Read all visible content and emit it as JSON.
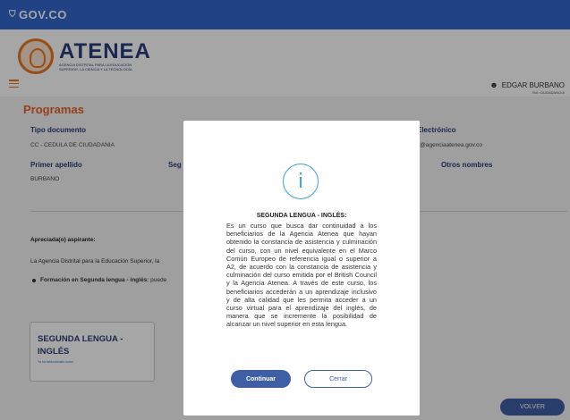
{
  "gov_bar": {
    "logo": "GOV.CO"
  },
  "brand": {
    "name": "ATENEA",
    "subtitle": "AGENCIA DISTRITAL PARA LA EDUCACIÓN SUPERIOR, LA CIENCIA Y LA TECNOLOGÍA"
  },
  "user": {
    "name": "EDGAR BURBANO",
    "role": "Rol: CIUDADANO/A"
  },
  "page": {
    "title": "Programas",
    "fields": {
      "tipo_documento_label": "Tipo documento",
      "tipo_documento_value": "CC - CEDULA DE CIUDADANIA",
      "correo_label": "Electrónico",
      "correo_value": "z@agenciaatenea.gov.co",
      "primer_apellido_label": "Primer apellido",
      "primer_apellido_value": "BURBANO",
      "segundo_label": "Seg",
      "otros_nombres_label": "Otros nombres"
    },
    "greeting": "Apreciada(o) aspirante:",
    "intro": "La Agencia Distrital para la Educación Superior, la",
    "bullet_bold": "Formación en Segunda lengua - inglés:",
    "bullet_rest": " puede",
    "program_card": {
      "title": "SEGUNDA LENGUA - INGLÉS",
      "status": "Ya ha seleccionado curso"
    },
    "volver_label": "VOLVER"
  },
  "modal": {
    "title": "SEGUNDA LENGUA - INGLÉS:",
    "body": "Es un curso que busca dar continuidad a los beneficiarios de la Agencia Atenea que hayan obtenido la constancia de asistencia y culminación del curso, con un nivel equivalente en el Marco Común Europeo de referencia igual o superior a A2, de acuerdo con la constancia de asistencia y culminación del curso emitida por el British Council y la Agencia Atenea. A través de este curso, los beneficiarios accederán a un aprendizaje inclusivo y de alta calidad que les permita acceder a un curso virtual para el aprendizaje del inglés, de manera que se incremente la posibilidad de alcanzar un nivel superior en esta lengua.",
    "continuar_label": "Continuar",
    "cerrar_label": "Cerrar",
    "icon": "info-icon"
  },
  "colors": {
    "gov_blue": "#3366cc",
    "accent_orange": "#e8632b",
    "brand_navy": "#2a3d7a",
    "button_blue": "#3e5fa3",
    "info_blue": "#3aa3d9"
  }
}
